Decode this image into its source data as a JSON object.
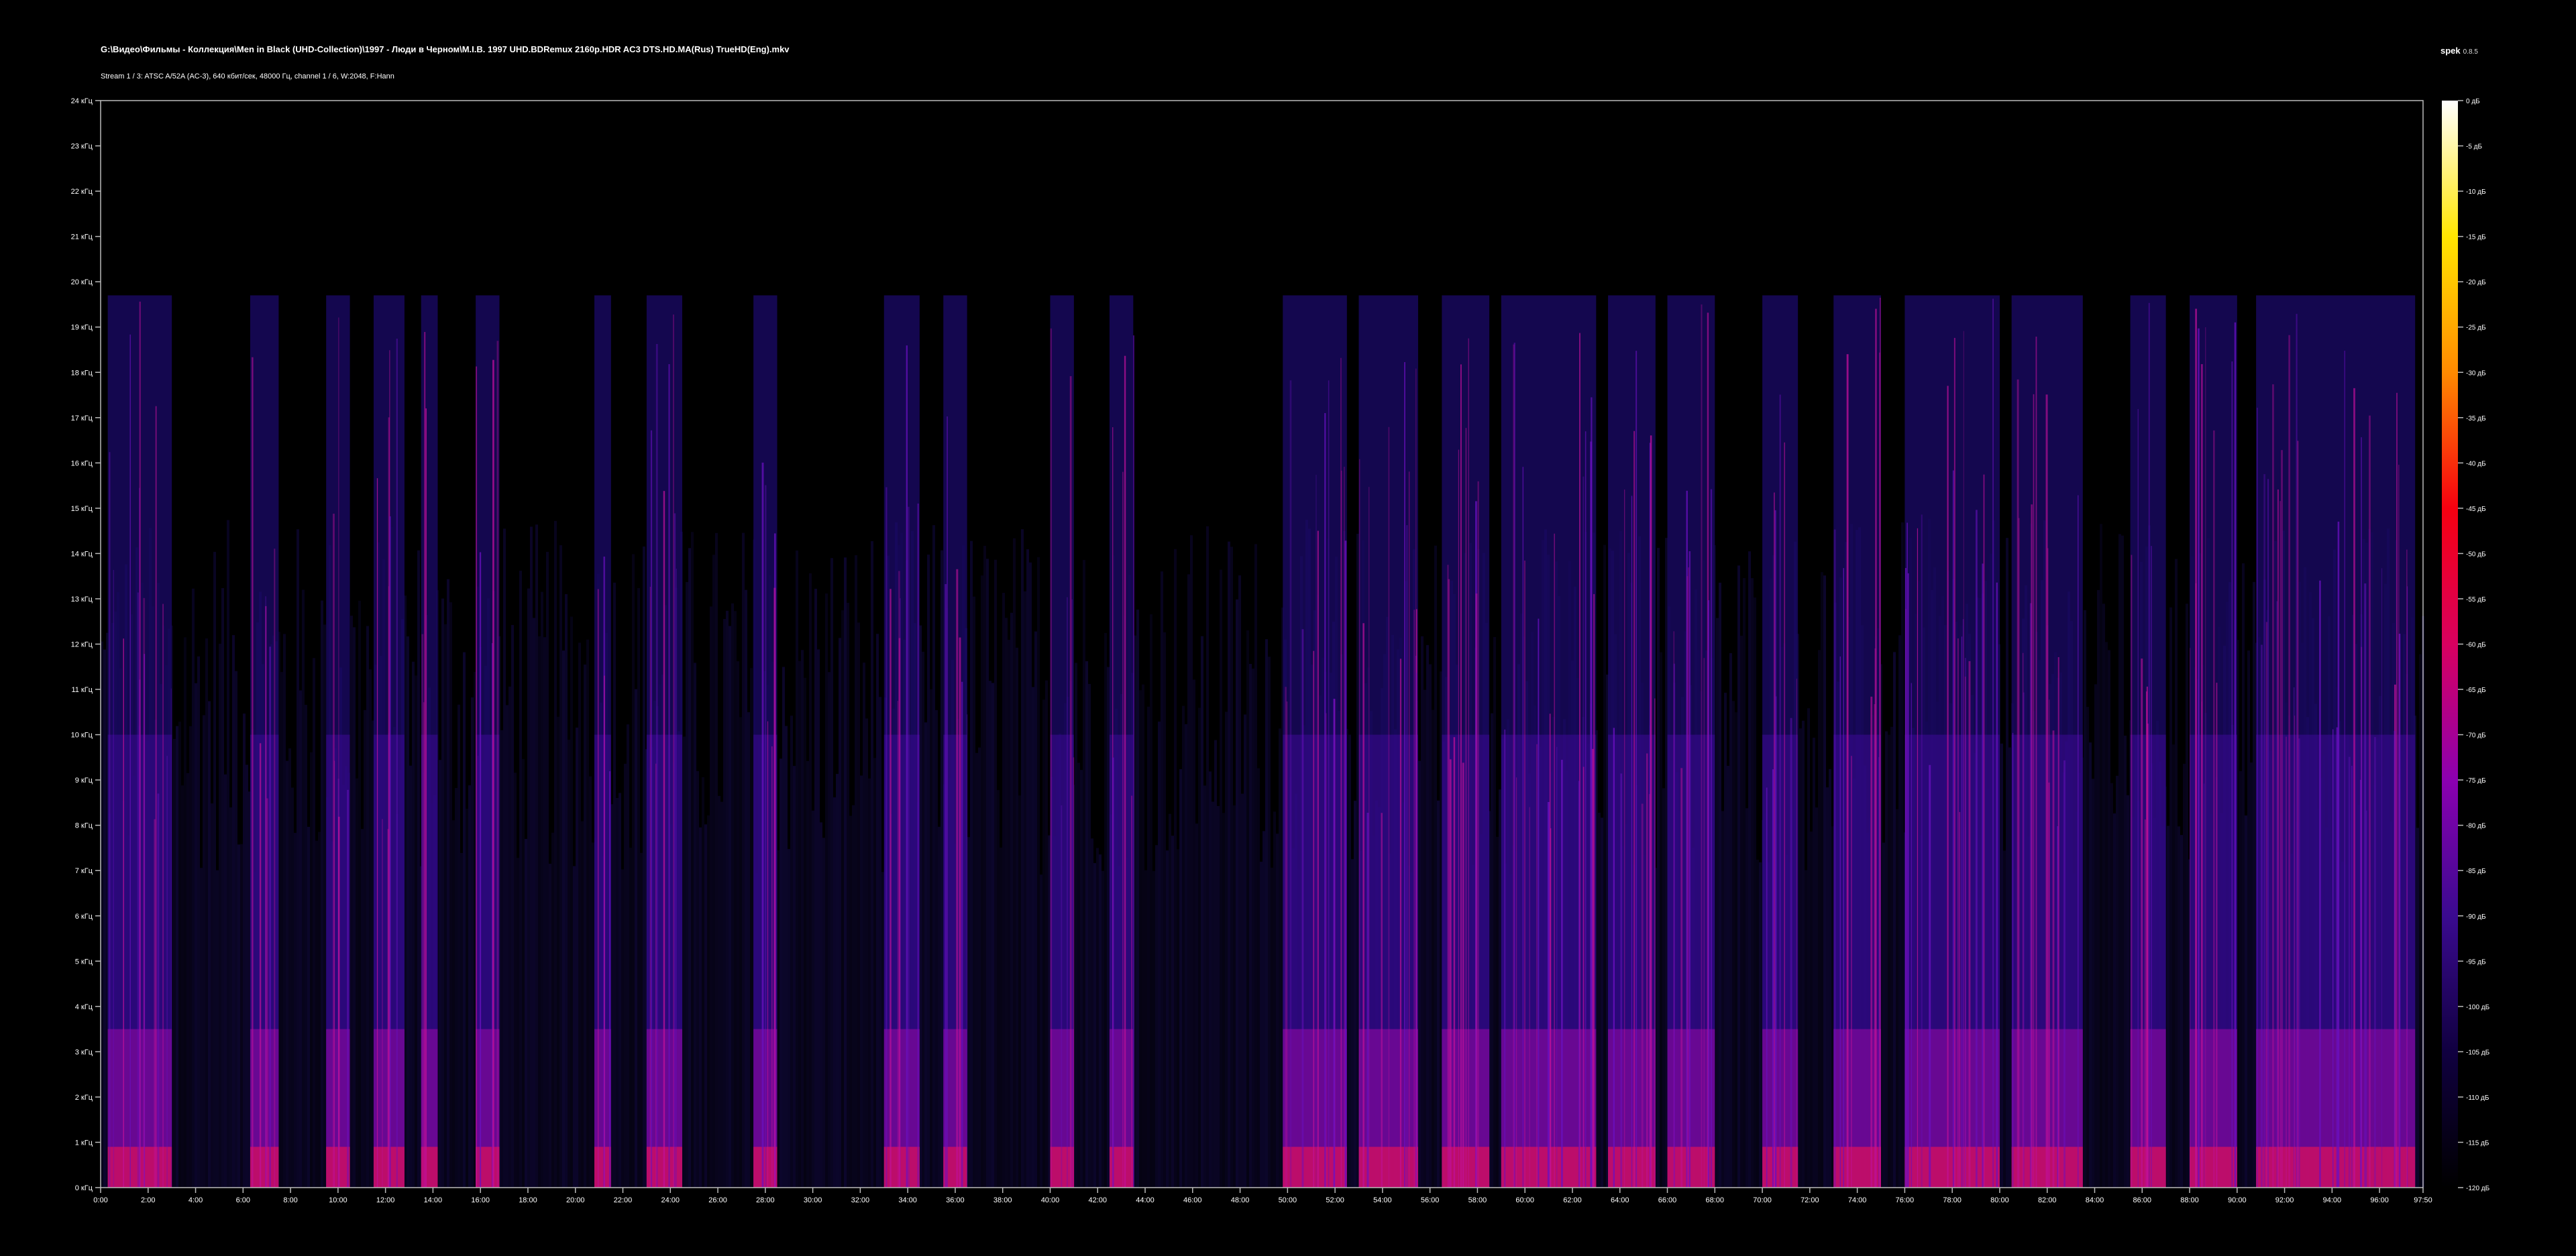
{
  "header": {
    "title": "G:\\Видео\\Фильмы - Коллекция\\Men in Black (UHD-Collection)\\1997 - Люди в Черном\\M.I.B. 1997 UHD.BDRemux 2160p.HDR AC3 DTS.HD.MA(Rus) TrueHD(Eng).mkv",
    "subtitle": "Stream 1 / 3: ATSC A/52A (AC-3), 640 кбит/сек, 48000 Гц, channel 1 / 6, W:2048, F:Hann",
    "app_name": "spek",
    "app_version": "0.8.5"
  },
  "chart_data": {
    "type": "heatmap",
    "title": "",
    "xlabel": "",
    "ylabel": "",
    "x_unit": "mm:ss",
    "x_range_seconds": [
      0,
      5870
    ],
    "x_ticks": [
      "0:00",
      "2:00",
      "4:00",
      "6:00",
      "8:00",
      "10:00",
      "12:00",
      "14:00",
      "16:00",
      "18:00",
      "20:00",
      "22:00",
      "24:00",
      "26:00",
      "28:00",
      "30:00",
      "32:00",
      "34:00",
      "36:00",
      "38:00",
      "40:00",
      "42:00",
      "44:00",
      "46:00",
      "48:00",
      "50:00",
      "52:00",
      "54:00",
      "56:00",
      "58:00",
      "60:00",
      "62:00",
      "64:00",
      "66:00",
      "68:00",
      "70:00",
      "72:00",
      "74:00",
      "76:00",
      "78:00",
      "80:00",
      "82:00",
      "84:00",
      "86:00",
      "88:00",
      "90:00",
      "92:00",
      "94:00",
      "96:00",
      "97:50"
    ],
    "y_unit": "кГц",
    "y_range_khz": [
      0,
      24
    ],
    "y_ticks": [
      "0 кГц",
      "1 кГц",
      "2 кГц",
      "3 кГц",
      "4 кГц",
      "5 кГц",
      "6 кГц",
      "7 кГц",
      "8 кГц",
      "9 кГц",
      "10 кГц",
      "11 кГц",
      "12 кГц",
      "13 кГц",
      "14 кГц",
      "15 кГц",
      "16 кГц",
      "17 кГц",
      "18 кГц",
      "19 кГц",
      "20 кГц",
      "21 кГц",
      "22 кГц",
      "23 кГц",
      "24 кГц"
    ],
    "colorbar_unit": "дБ",
    "colorbar_range_db": [
      -120,
      0
    ],
    "colorbar_ticks": [
      "0 дБ",
      "-5 дБ",
      "-10 дБ",
      "-15 дБ",
      "-20 дБ",
      "-25 дБ",
      "-30 дБ",
      "-35 дБ",
      "-40 дБ",
      "-45 дБ",
      "-50 дБ",
      "-55 дБ",
      "-60 дБ",
      "-65 дБ",
      "-70 дБ",
      "-75 дБ",
      "-80 дБ",
      "-85 дБ",
      "-90 дБ",
      "-95 дБ",
      "-100 дБ",
      "-105 дБ",
      "-110 дБ",
      "-115 дБ",
      "-120 дБ"
    ],
    "colormap": [
      "#000000",
      "#100040",
      "#3a0a90",
      "#8b00b0",
      "#d8005f",
      "#f60010",
      "#ff8a00",
      "#ffe600",
      "#ffffff"
    ],
    "spectral_cutoff_khz": 19.7,
    "loud_sections_minutes": [
      [
        0.3,
        3.0
      ],
      [
        6.3,
        7.5
      ],
      [
        9.5,
        10.5
      ],
      [
        11.5,
        12.8
      ],
      [
        13.5,
        14.2
      ],
      [
        15.8,
        16.8
      ],
      [
        20.8,
        21.5
      ],
      [
        23.0,
        24.5
      ],
      [
        27.5,
        28.5
      ],
      [
        33.0,
        34.5
      ],
      [
        35.5,
        36.5
      ],
      [
        40.0,
        41.0
      ],
      [
        42.5,
        43.5
      ],
      [
        49.8,
        52.5
      ],
      [
        53.0,
        55.5
      ],
      [
        56.5,
        58.5
      ],
      [
        59.0,
        63.0
      ],
      [
        63.5,
        65.5
      ],
      [
        66.0,
        68.0
      ],
      [
        70.0,
        71.5
      ],
      [
        73.0,
        75.0
      ],
      [
        76.0,
        80.0
      ],
      [
        80.5,
        83.5
      ],
      [
        85.5,
        87.0
      ],
      [
        88.0,
        90.0
      ],
      [
        90.8,
        97.5
      ]
    ]
  }
}
